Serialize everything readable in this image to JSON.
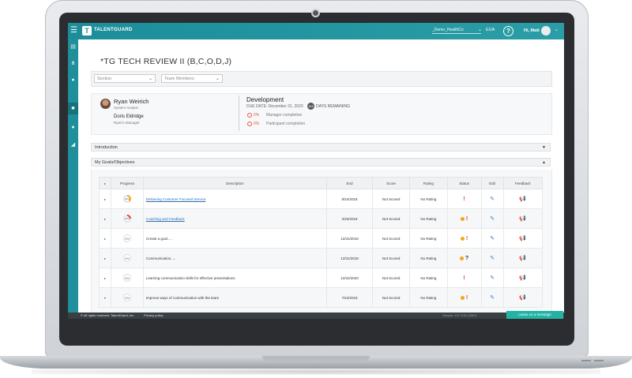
{
  "app": {
    "brand": "TALENTGUARD",
    "tenant": "_Demo_HealthCo",
    "language": "EUA",
    "greeting": "Hi, Matt"
  },
  "page": {
    "title": "*TG TECH REVIEW II (B,C,O,D,J)",
    "filters": {
      "section_placeholder": "Section",
      "team_placeholder": "Team Members"
    }
  },
  "profile": {
    "employee_name": "Ryan Weirich",
    "employee_title": "System Analyst",
    "manager_name": "Doris Eldridge",
    "manager_label": "Ryan's Manager",
    "dev_title": "Development",
    "due_date": "DUE DATE: December 31, 2020",
    "days_remaining": "365",
    "days_label": "DAYS REMAINING",
    "manager_pct": "0%",
    "manager_completion": "Manager completion",
    "participant_pct": "0%",
    "participant_completion": "Participant completion"
  },
  "sections": {
    "introduction": "Introduction",
    "goals": "My Goals/Objectives"
  },
  "table": {
    "headers": [
      "Progress",
      "Description",
      "End",
      "Score",
      "Rating",
      "Status",
      "Edit",
      "Feedback"
    ],
    "rows": [
      {
        "progress": "40%",
        "description": "Delivering Customer Focused Service",
        "end": "9/24/2018",
        "score": "Not Scored",
        "rating": "No Rating"
      },
      {
        "progress": "25%",
        "description": "Coaching and Feedback",
        "end": "4/20/2018",
        "score": "Not Scored",
        "rating": "No Rating"
      },
      {
        "progress": "0%",
        "description": "Create a goal.....",
        "end": "12/31/2018",
        "score": "Not Scored",
        "rating": "No Rating"
      },
      {
        "progress": "0%",
        "description": "Communication.....",
        "end": "12/31/2018",
        "score": "Not Scored",
        "rating": "No Rating"
      },
      {
        "progress": "0%",
        "description": "Learning communication skills for effective presentations",
        "end": "12/22/2020",
        "score": "Not Scored",
        "rating": "No Rating"
      },
      {
        "progress": "0%",
        "description": "Improve ways of communication with the team",
        "end": "7/24/2019",
        "score": "Not Scored",
        "rating": "No Rating"
      }
    ]
  },
  "footer": {
    "copyright": "© All rights reserved. TalentGuard, Inc",
    "policy": "Privacy policy",
    "version": "Version: 9.0.7161.25674",
    "leave_message": "Leave us a message"
  },
  "colors": {
    "brand": "#1f8f9b",
    "alert": "#e23b2e",
    "warning": "#f2a71b",
    "link": "#2b6fb3"
  },
  "icons": [
    "menu-icon",
    "help-icon",
    "chevron-down-icon",
    "pencil-icon",
    "megaphone-icon",
    "exclamation-icon",
    "question-icon"
  ]
}
